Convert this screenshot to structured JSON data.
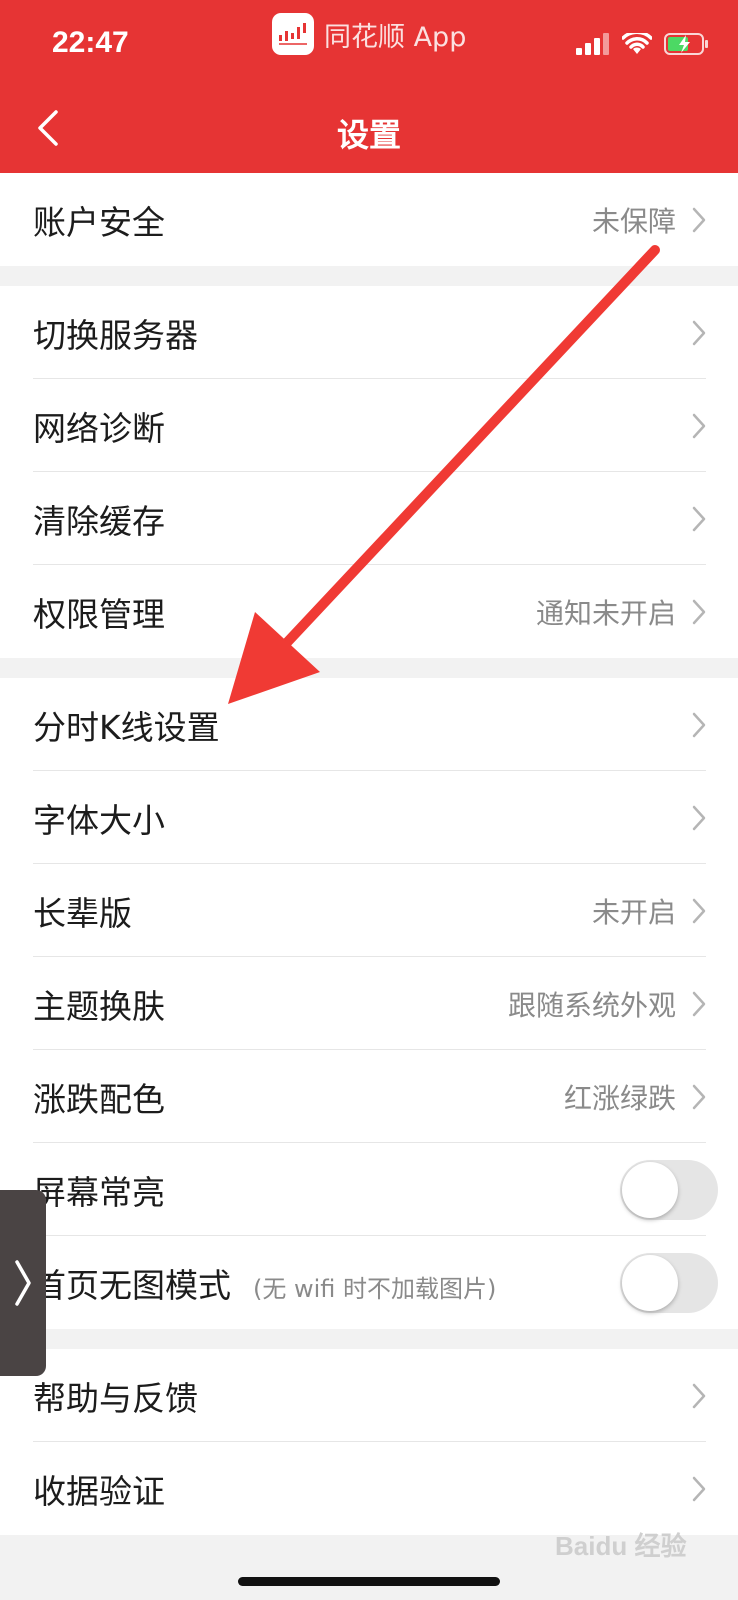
{
  "status": {
    "time": "22:47",
    "app_name": "同花顺 App"
  },
  "nav": {
    "title": "设置"
  },
  "groups": [
    [
      {
        "label": "账户安全",
        "value": "未保障"
      }
    ],
    [
      {
        "label": "切换服务器",
        "value": ""
      },
      {
        "label": "网络诊断",
        "value": ""
      },
      {
        "label": "清除缓存",
        "value": ""
      },
      {
        "label": "权限管理",
        "value": "通知未开启"
      }
    ],
    [
      {
        "label": "分时K线设置",
        "value": ""
      },
      {
        "label": "字体大小",
        "value": ""
      },
      {
        "label": "长辈版",
        "value": "未开启"
      },
      {
        "label": "主题换肤",
        "value": "跟随系统外观"
      },
      {
        "label": "涨跌配色",
        "value": "红涨绿跌"
      },
      {
        "label": "屏幕常亮",
        "toggle": false
      },
      {
        "label": "首页无图模式",
        "hint": "(无 wifi 时不加载图片)",
        "toggle": false
      }
    ],
    [
      {
        "label": "帮助与反馈",
        "value": ""
      },
      {
        "label": "收据验证",
        "value": ""
      }
    ]
  ],
  "watermark": "Baidu 经验",
  "colors": {
    "header_bg": "#e63434",
    "annotation_arrow": "#f03a34"
  }
}
